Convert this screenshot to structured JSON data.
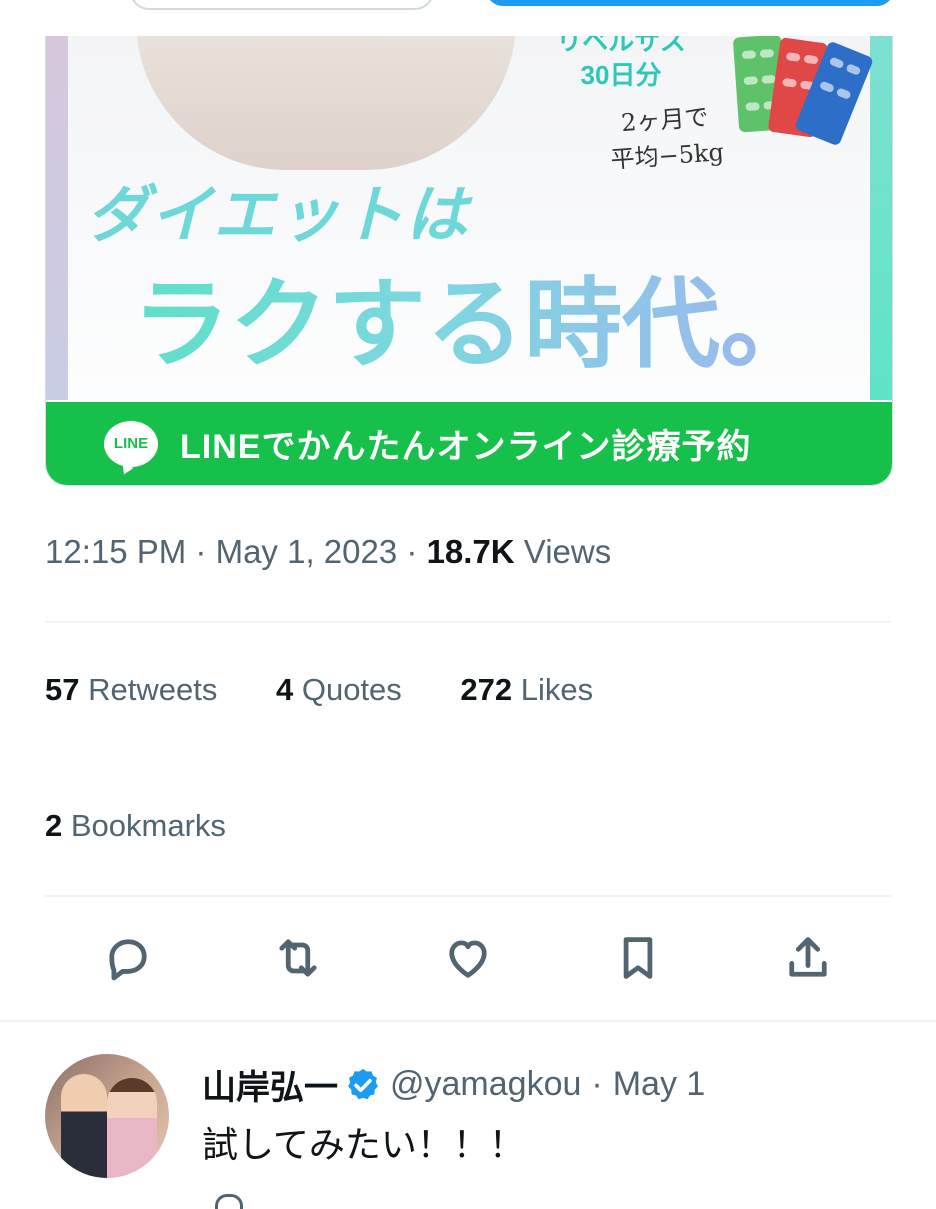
{
  "media": {
    "ad_small_lines": [
      "リベルサス",
      "30日分"
    ],
    "ad_note_lines": [
      "2ヶ月で",
      "平均−5kg"
    ],
    "headline_1": "ダイエットは",
    "headline_2": "ラクする時代。",
    "line_logo": "LINE",
    "line_cta": "LINEでかんたんオンライン診療予約"
  },
  "meta": {
    "time": "12:15 PM",
    "separator": "·",
    "date": "May 1, 2023",
    "views_count": "18.7K",
    "views_label": "Views"
  },
  "stats": {
    "retweets_count": "57",
    "retweets_label": "Retweets",
    "quotes_count": "4",
    "quotes_label": "Quotes",
    "likes_count": "272",
    "likes_label": "Likes",
    "bookmarks_count": "2",
    "bookmarks_label": "Bookmarks"
  },
  "actions": [
    {
      "icon": "reply-icon"
    },
    {
      "icon": "retweet-icon"
    },
    {
      "icon": "like-icon"
    },
    {
      "icon": "bookmark-icon"
    },
    {
      "icon": "share-icon"
    }
  ],
  "reply": {
    "name": "山岸弘一",
    "verified_icon": "verified-badge-icon",
    "handle": "@yamagkou",
    "separator": "·",
    "date": "May 1",
    "text": "試してみたい！！！"
  },
  "colors": {
    "accent": "#1d9bf0",
    "line_green": "#17c04a",
    "muted_text": "#536471",
    "main_text": "#0f1419"
  }
}
